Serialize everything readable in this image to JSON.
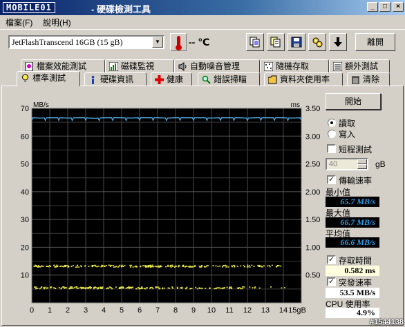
{
  "app": {
    "logo_text": "MOBILE01",
    "title": "- 硬碟檢測工具",
    "window_buttons": {
      "minimize": "_",
      "maximize": "□",
      "close": "×"
    }
  },
  "menu": [
    {
      "label": "檔案(F)"
    },
    {
      "label": "說明(H)"
    }
  ],
  "toolbar": {
    "drive": "JetFlashTranscend 16GB  (15 gB)",
    "temperature": "-- ℃",
    "exit_label": "離開",
    "icons": [
      "copy-icon",
      "copy-text-icon",
      "save-icon",
      "settings-icon",
      "down-arrow-icon"
    ]
  },
  "tabs_row1": [
    {
      "label": "檔案效能測試",
      "icon": "file-benchmark-icon"
    },
    {
      "label": "磁碟監視",
      "icon": "bar-chart-icon"
    },
    {
      "label": "自動噪音管理",
      "icon": "speaker-icon"
    },
    {
      "label": "隨機存取",
      "icon": "random-access-icon"
    },
    {
      "label": "額外測試",
      "icon": "extra-test-icon"
    }
  ],
  "tabs_row2": [
    {
      "label": "標準測試",
      "icon": "lightbulb-icon",
      "active": true
    },
    {
      "label": "硬碟資訊",
      "icon": "info-icon"
    },
    {
      "label": "健康",
      "icon": "health-cross-icon"
    },
    {
      "label": "錯誤掃瞄",
      "icon": "magnifier-icon"
    },
    {
      "label": "資料夾使用率",
      "icon": "folder-icon"
    },
    {
      "label": "清除",
      "icon": "trash-icon"
    }
  ],
  "controls": {
    "start_label": "開始",
    "read_label": "讀取",
    "write_label": "寫入",
    "short_test_label": "短程測試",
    "short_test_value": "40",
    "short_test_unit": "gB",
    "transfer_rate_label": "傳輸速率",
    "min_label": "最小值",
    "min_value": "65.7 MB/s",
    "max_label": "最大值",
    "max_value": "66.7 MB/s",
    "avg_label": "平均值",
    "avg_value": "66.6 MB/s",
    "access_time_label": "存取時間",
    "access_time_value": "0.582 ms",
    "burst_label": "突發速率",
    "burst_value": "53.5 MB/s",
    "cpu_label": "CPU 使用率",
    "cpu_value": "4.9%"
  },
  "watermark": "#1544138",
  "chart_data": {
    "type": "line",
    "left_axis_unit": "MB/s",
    "right_axis_unit": "ms",
    "x_unit": "gB",
    "x_ticks": [
      "0",
      "1",
      "2",
      "3",
      "4",
      "5",
      "6",
      "7",
      "8",
      "9",
      "10",
      "11",
      "12",
      "13",
      "14",
      "15gB"
    ],
    "y_left_ticks": [
      "70",
      "60",
      "50",
      "40",
      "30",
      "20",
      "10"
    ],
    "y_right_ticks": [
      "3.50",
      "3.00",
      "2.50",
      "2.00",
      "1.50",
      "1.00",
      "0.50"
    ],
    "xlim": [
      0,
      15
    ],
    "ylim_left": [
      0,
      70
    ],
    "ylim_right": [
      0,
      3.5
    ],
    "grid": true,
    "series": [
      {
        "name": "transfer-rate",
        "color": "#4fa8e0",
        "x": [
          0,
          0.5,
          1,
          1.5,
          2,
          2.5,
          3,
          3.5,
          4,
          4.5,
          5,
          5.5,
          6,
          6.5,
          7,
          7.5,
          8,
          8.5,
          9,
          9.5,
          10,
          10.5,
          11,
          11.5,
          12,
          12.5,
          13,
          13.5,
          14,
          14.5,
          15
        ],
        "values": [
          66.6,
          66.5,
          66.6,
          66.6,
          66.5,
          66.6,
          66.6,
          66.4,
          66.6,
          66.6,
          66.6,
          66.5,
          66.6,
          66.6,
          66.6,
          66.5,
          66.6,
          66.6,
          66.6,
          66.6,
          66.5,
          66.6,
          66.6,
          66.6,
          66.5,
          66.6,
          66.6,
          66.6,
          66.6,
          66.5,
          66.6
        ]
      },
      {
        "name": "access-time-upper",
        "color": "#e8e84a",
        "x": [
          0.1,
          1,
          2,
          3,
          4,
          5,
          6,
          7,
          8,
          9,
          10,
          11,
          12,
          13,
          14.2
        ],
        "values": [
          0.67,
          0.67,
          0.67,
          0.67,
          0.67,
          0.67,
          0.67,
          0.67,
          0.67,
          0.67,
          0.67,
          0.67,
          0.67,
          0.67,
          0.67
        ]
      },
      {
        "name": "access-time-lower",
        "color": "#e8e84a",
        "x": [
          0.1,
          1,
          2,
          3,
          4,
          5,
          6,
          7,
          8,
          9,
          10,
          11,
          12,
          13,
          14.2
        ],
        "values": [
          0.28,
          0.28,
          0.28,
          0.28,
          0.28,
          0.28,
          0.28,
          0.28,
          0.28,
          0.28,
          0.28,
          0.28,
          0.28,
          0.28,
          0.28
        ]
      }
    ]
  }
}
